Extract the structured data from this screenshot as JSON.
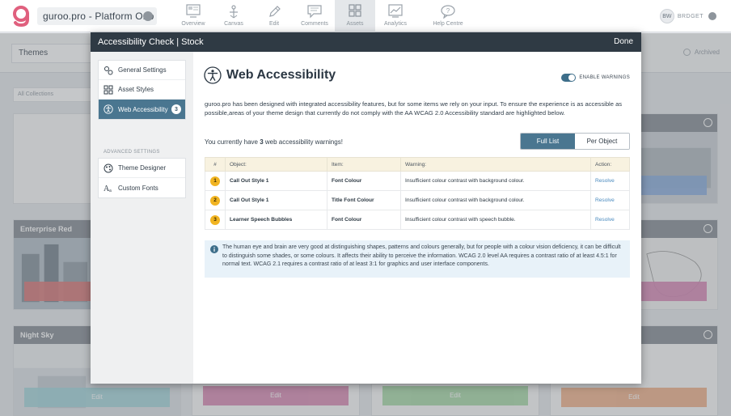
{
  "topbar": {
    "project_name": "guroo.pro - Platform Onb",
    "nav": [
      {
        "label": "Overview",
        "icon": "overview-icon"
      },
      {
        "label": "Canvas",
        "icon": "canvas-icon"
      },
      {
        "label": "Edit",
        "icon": "edit-icon"
      },
      {
        "label": "Comments",
        "icon": "comments-icon"
      },
      {
        "label": "Assets",
        "icon": "assets-icon"
      },
      {
        "label": "Analytics",
        "icon": "analytics-icon"
      },
      {
        "label": "Help Centre",
        "icon": "help-centre-icon"
      }
    ],
    "active_nav": "Assets",
    "user_initials": "BW",
    "user_name": "BRDGET"
  },
  "background": {
    "themes_label": "Themes",
    "archived_label": "Archived",
    "collections_label": "All Collections",
    "cards": [
      {
        "title": "Enterprise Red",
        "button": "",
        "color": "#e07d7d"
      },
      {
        "title": "Night Sky",
        "button": "Edit",
        "color": "#a7d8de"
      },
      {
        "title": "",
        "button": "Edit",
        "color": "#d989b4"
      },
      {
        "title": "",
        "button": "Edit",
        "color": "#a6d9a6"
      },
      {
        "title": "",
        "button": "Edit",
        "color": "#f2b08a"
      },
      {
        "title": "",
        "button": "",
        "color": "#8fb0e0"
      },
      {
        "title": "",
        "button": "",
        "color": "#d98ab8"
      }
    ]
  },
  "modal": {
    "title": "Accessibility Check | Stock",
    "done_label": "Done",
    "sidebar": {
      "items": [
        {
          "label": "General Settings",
          "icon": "general-settings-icon"
        },
        {
          "label": "Asset Styles",
          "icon": "asset-styles-icon"
        },
        {
          "label": "Web Accessibility",
          "icon": "accessibility-icon",
          "badge": "3"
        }
      ],
      "advanced_heading": "ADVANCED SETTINGS",
      "advanced_items": [
        {
          "label": "Theme Designer",
          "icon": "theme-designer-icon"
        },
        {
          "label": "Custom Fonts",
          "icon": "custom-fonts-icon"
        }
      ]
    },
    "content": {
      "title": "Web Accessibility",
      "toggle_label": "ENABLE WARNINGS",
      "toggle_on": true,
      "intro": "guroo.pro has been designed with integrated accessibility features, but for some items we rely on your input. To ensure the experience is as accessible as possible,areas of your theme design that currently do not comply with the AA WCAG 2.0 Accessibility standard are highlighted below.",
      "warn_prefix": "You currently have ",
      "warn_count": "3",
      "warn_suffix": " web accessibility warnings!",
      "view_full": "Full List",
      "view_per_object": "Per Object",
      "table": {
        "headers": [
          "#",
          "Object:",
          "Item:",
          "Warning:",
          "Action:"
        ],
        "rows": [
          {
            "num": "1",
            "object": "Call Out Style 1",
            "item": "Font Colour",
            "warning": "Insufficient colour contrast with background colour.",
            "action": "Resolve"
          },
          {
            "num": "2",
            "object": "Call Out Style 1",
            "item": "Title Font Colour",
            "warning": "Insufficient colour contrast with background colour.",
            "action": "Resolve"
          },
          {
            "num": "3",
            "object": "Learner Speech Bubbles",
            "item": "Font Colour",
            "warning": "Insufficient colour contrast with speech bubble.",
            "action": "Resolve"
          }
        ]
      },
      "info": "The human eye and brain are very good at distinguishing shapes, patterns and colours generally, but for people with a colour vision deficiency, it can be difficult to distinguish some shades, or some colours. It affects their ability to perceive the information. WCAG 2.0 level AA requires a contrast ratio of at least 4.5:1 for normal text. WCAG 2.1 requires a contrast ratio of at least 3:1 for graphics and user interface components."
    }
  },
  "colors": {
    "accent": "#4a7690",
    "header_dark": "#2f3a44",
    "badge_yellow": "#f1b421",
    "logo_pink": "#e0607e",
    "info_bg": "#e8f2f9"
  }
}
